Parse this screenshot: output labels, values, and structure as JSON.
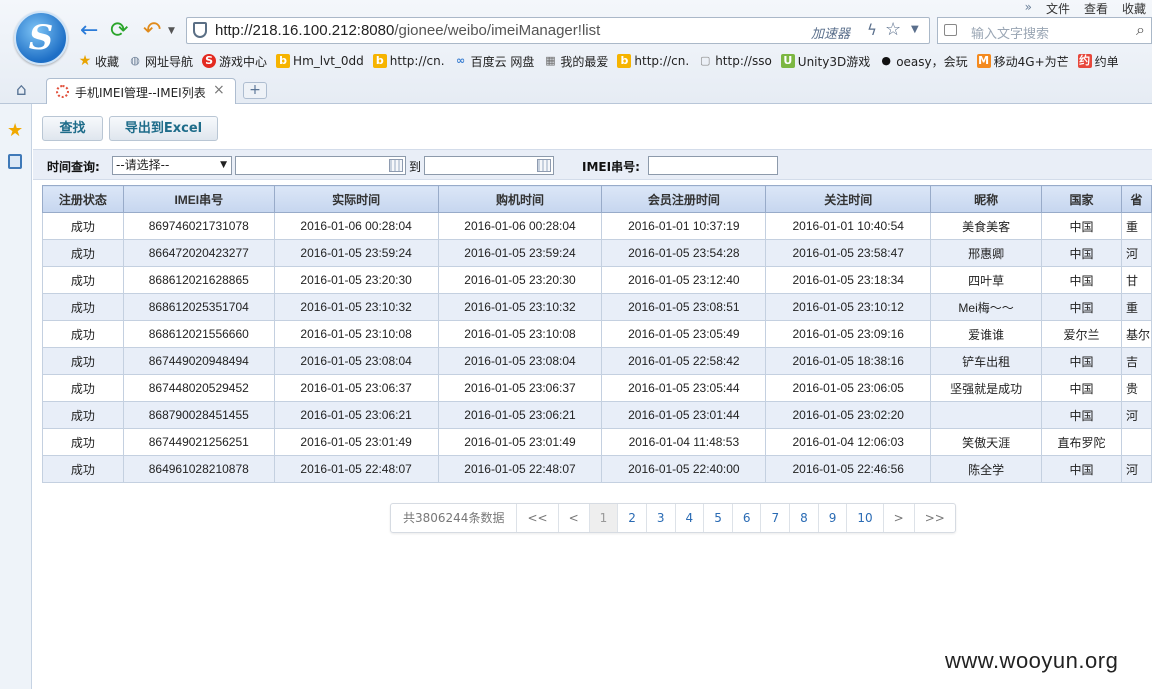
{
  "browser": {
    "menu": [
      "文件",
      "查看",
      "收藏"
    ],
    "url_prefix": "http://218.16.100.212:8080",
    "url_path": "/gionee/weibo/imeiManager!list",
    "accelerator": "加速器",
    "search_placeholder": "输入文字搜索",
    "bookmarks": [
      {
        "label": "收藏",
        "icon": "star-icon"
      },
      {
        "label": "网址导航",
        "icon": "globe-icon"
      },
      {
        "label": "游戏中心",
        "icon": "game-icon"
      },
      {
        "label": "Hm_lvt_0dd",
        "icon": "bing-icon"
      },
      {
        "label": "http://cn.",
        "icon": "bing-icon"
      },
      {
        "label": "百度云 网盘",
        "icon": "cloud-icon"
      },
      {
        "label": "我的最爱",
        "icon": "grid-icon"
      },
      {
        "label": "http://cn.",
        "icon": "bing-icon"
      },
      {
        "label": "http://sso",
        "icon": "page-icon"
      },
      {
        "label": "Unity3D游戏",
        "icon": "unity-icon"
      },
      {
        "label": "oeasy，会玩",
        "icon": "github-icon"
      },
      {
        "label": "移动4G+为芒",
        "icon": "mgtv-icon"
      },
      {
        "label": "约单",
        "icon": "yue-icon"
      }
    ],
    "tab_title": "手机IMEI管理--IMEI列表"
  },
  "toolbar": {
    "find": "查找",
    "export": "导出到Excel"
  },
  "filters": {
    "time_label": "时间查询:",
    "select_value": "--请选择--",
    "to_label": "到",
    "imei_label": "IMEI串号:"
  },
  "table": {
    "headers": [
      "注册状态",
      "IMEI串号",
      "实际时间",
      "购机时间",
      "会员注册时间",
      "关注时间",
      "昵称",
      "国家",
      "省"
    ],
    "rows": [
      [
        "成功",
        "869746021731078",
        "2016-01-06 00:28:04",
        "2016-01-06 00:28:04",
        "2016-01-01 10:37:19",
        "2016-01-01 10:40:54",
        "美食美客",
        "中国",
        "重"
      ],
      [
        "成功",
        "866472020423277",
        "2016-01-05 23:59:24",
        "2016-01-05 23:59:24",
        "2016-01-05 23:54:28",
        "2016-01-05 23:58:47",
        "邢惠卿",
        "中国",
        "河"
      ],
      [
        "成功",
        "868612021628865",
        "2016-01-05 23:20:30",
        "2016-01-05 23:20:30",
        "2016-01-05 23:12:40",
        "2016-01-05 23:18:34",
        "四叶草",
        "中国",
        "甘"
      ],
      [
        "成功",
        "868612025351704",
        "2016-01-05 23:10:32",
        "2016-01-05 23:10:32",
        "2016-01-05 23:08:51",
        "2016-01-05 23:10:12",
        "Mei梅～～",
        "中国",
        "重"
      ],
      [
        "成功",
        "868612021556660",
        "2016-01-05 23:10:08",
        "2016-01-05 23:10:08",
        "2016-01-05 23:05:49",
        "2016-01-05 23:09:16",
        "爱谁谁",
        "爱尔兰",
        "基尔"
      ],
      [
        "成功",
        "867449020948494",
        "2016-01-05 23:08:04",
        "2016-01-05 23:08:04",
        "2016-01-05 22:58:42",
        "2016-01-05 18:38:16",
        "铲车出租",
        "中国",
        "吉"
      ],
      [
        "成功",
        "867448020529452",
        "2016-01-05 23:06:37",
        "2016-01-05 23:06:37",
        "2016-01-05 23:05:44",
        "2016-01-05 23:06:05",
        "坚强就是成功",
        "中国",
        "贵"
      ],
      [
        "成功",
        "868790028451455",
        "2016-01-05 23:06:21",
        "2016-01-05 23:06:21",
        "2016-01-05 23:01:44",
        "2016-01-05 23:02:20",
        "",
        "中国",
        "河"
      ],
      [
        "成功",
        "867449021256251",
        "2016-01-05 23:01:49",
        "2016-01-05 23:01:49",
        "2016-01-04 11:48:53",
        "2016-01-04 12:06:03",
        "笑傲天涯",
        "直布罗陀",
        ""
      ],
      [
        "成功",
        "864961028210878",
        "2016-01-05 22:48:07",
        "2016-01-05 22:48:07",
        "2016-01-05 22:40:00",
        "2016-01-05 22:46:56",
        "陈全学",
        "中国",
        "河"
      ]
    ]
  },
  "pager": {
    "total": "共3806244条数据",
    "first": "<<",
    "prev": "<",
    "pages": [
      "1",
      "2",
      "3",
      "4",
      "5",
      "6",
      "7",
      "8",
      "9",
      "10"
    ],
    "next": ">",
    "last": ">>"
  },
  "watermark": "www.wooyun.org"
}
